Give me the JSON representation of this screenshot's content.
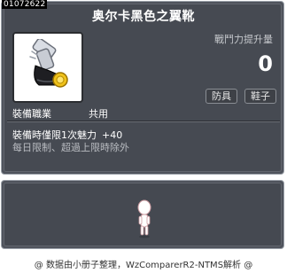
{
  "item": {
    "id": "01072622",
    "name": "奥尔卡黑色之翼靴",
    "icon": "orca-black-wing-shoes-icon"
  },
  "stats": {
    "power_label": "戰鬥力提升量",
    "power_value": "0"
  },
  "tags": {
    "armor": "防具",
    "shoes": "鞋子"
  },
  "job": {
    "label": "裝備職業",
    "value": "共用"
  },
  "effects": {
    "equip_text": "裝備時僅限1次魅力",
    "equip_bonus": "+40",
    "limit_text": "每日限制、超過上限時除外"
  },
  "preview": {
    "icon": "mannequin-icon"
  },
  "footer": {
    "text": "@ 数据由小册子整理，WzComparerR2-NTMS解析 @"
  },
  "colors": {
    "panel": "#4f535c",
    "panel_border": "#9aa0a8",
    "text_primary": "#ffffff",
    "text_muted": "#b9bcc1"
  }
}
